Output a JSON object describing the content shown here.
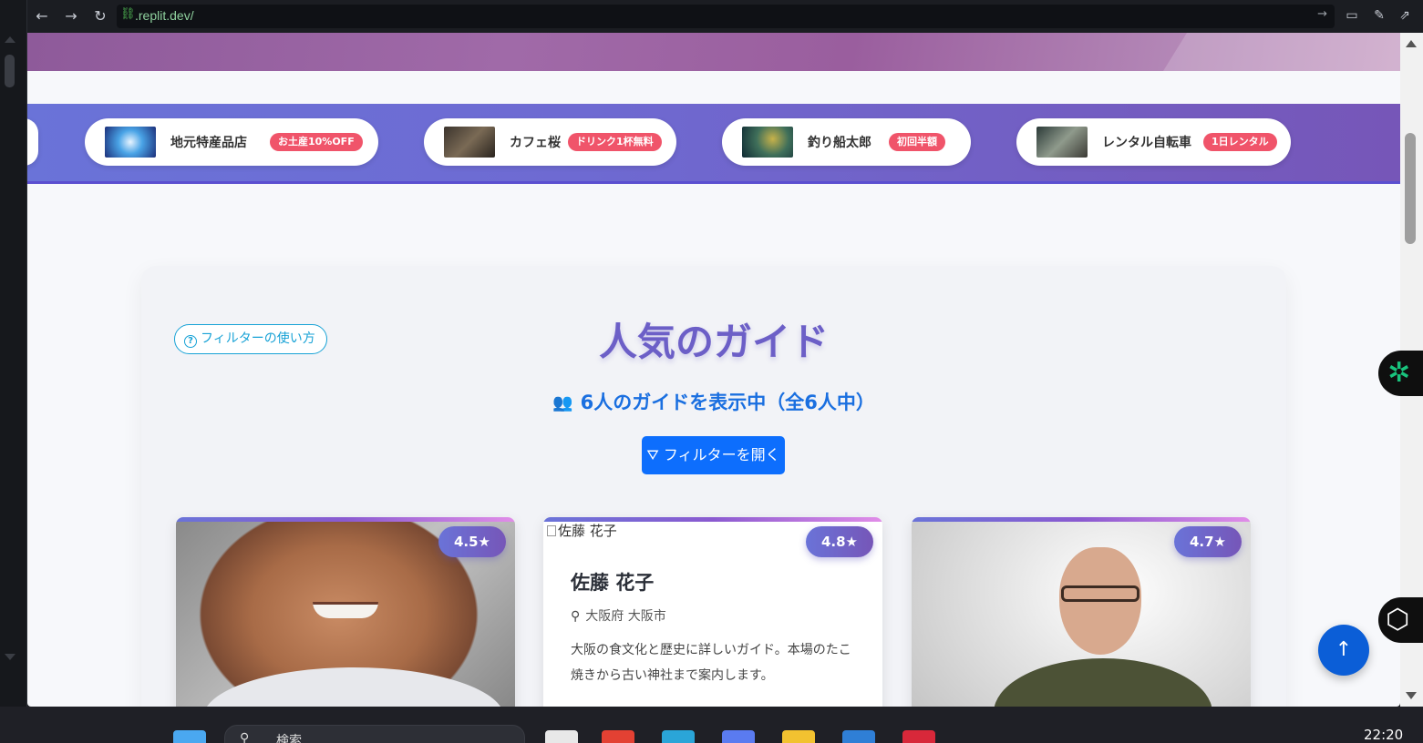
{
  "browser": {
    "url": ".replit.dev/",
    "back_icon": "←",
    "forward_icon": "→",
    "reload_icon": "↻",
    "link_icon": "🔗",
    "go_icon": "→"
  },
  "sponsors": [
    {
      "name": "地元特産品店",
      "deal": "お土産10%OFF"
    },
    {
      "name": "カフェ桜",
      "deal": "ドリンク1杯無料"
    },
    {
      "name": "釣り船太郎",
      "deal": "初回半額"
    },
    {
      "name": "レンタル自転車",
      "deal": "1日レンタル"
    }
  ],
  "section": {
    "filter_help": "フィルターの使い方",
    "title": "人気のガイド",
    "count": "6人のガイドを表示中（全6人中）",
    "open_filter": "フィルターを開く"
  },
  "guides": [
    {
      "rating": "4.5★"
    },
    {
      "rating": "4.8★",
      "img_alt": "佐藤 花子",
      "name": "佐藤 花子",
      "location": "大阪府 大阪市",
      "description": "大阪の食文化と歴史に詳しいガイド。本場のたこ焼きから古い神社まで案内します。"
    },
    {
      "rating": "4.7★"
    }
  ],
  "taskbar": {
    "search_label": "検索",
    "clock": "22:20"
  },
  "colors": {
    "accent": "#6c5fc7",
    "primary": "#0d6efd",
    "deal_badge": "#f0546a"
  }
}
